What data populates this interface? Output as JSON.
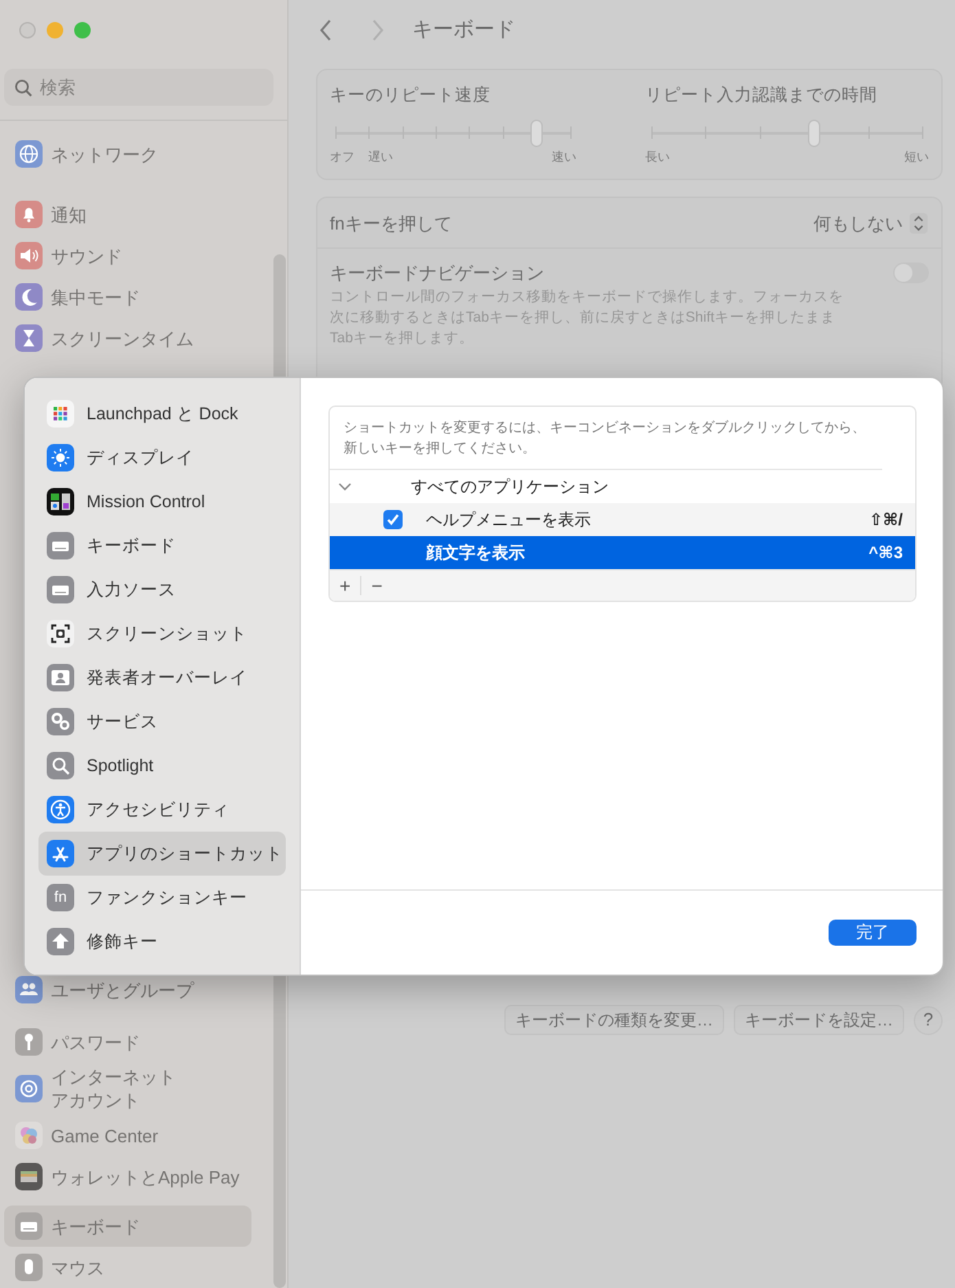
{
  "window": {
    "title": "キーボード"
  },
  "sidebar": {
    "search": {
      "placeholder": "検索"
    },
    "groups": [
      [
        {
          "label": "ネットワーク",
          "selected": false
        }
      ],
      [
        {
          "label": "通知",
          "selected": false
        },
        {
          "label": "サウンド",
          "selected": false
        },
        {
          "label": "集中モード",
          "selected": false
        },
        {
          "label": "スクリーンタイム",
          "selected": false
        }
      ],
      [
        {
          "label": "ユーザとグループ",
          "selected": false
        }
      ],
      [
        {
          "label": "パスワード",
          "selected": false
        },
        {
          "label": "インターネットアカウント",
          "selected": false
        },
        {
          "label": "Game Center",
          "selected": false
        },
        {
          "label": "ウォレットとApple Pay",
          "selected": false
        }
      ],
      [
        {
          "label": "キーボード",
          "selected": true
        },
        {
          "label": "マウス",
          "selected": false
        }
      ]
    ]
  },
  "repeat": {
    "sliders": [
      {
        "label": "キーのリピート速度",
        "level": 0.857,
        "left_labels": [
          "オフ",
          "遅い"
        ],
        "right_label": "速い"
      },
      {
        "label": "リピート入力認識までの時間",
        "level": 0.6,
        "left_labels": [
          "長い"
        ],
        "right_label": "短い"
      }
    ]
  },
  "fn_row": {
    "label": "fnキーを押して",
    "value": "何もしない"
  },
  "navigation": {
    "title": "キーボードナビゲーション",
    "description": "コントロール間のフォーカス移動をキーボードで操作します。フォーカスを次に移動するときはTabキーを押し、前に戻すときはShiftキーを押したままTabキーを押します。",
    "on": false
  },
  "buttons": [
    "キーボードの種類を変更…",
    "キーボードを設定…"
  ],
  "help": "?",
  "sheet": {
    "categories": [
      {
        "label": "Launchpad と Dock",
        "selected": false
      },
      {
        "label": "ディスプレイ",
        "selected": false
      },
      {
        "label": "Mission Control",
        "selected": false
      },
      {
        "label": "キーボード",
        "selected": false
      },
      {
        "label": "入力ソース",
        "selected": false
      },
      {
        "label": "スクリーンショット",
        "selected": false
      },
      {
        "label": "発表者オーバーレイ",
        "selected": false
      },
      {
        "label": "サービス",
        "selected": false
      },
      {
        "label": "Spotlight",
        "selected": false
      },
      {
        "label": "アクセシビリティ",
        "selected": false
      },
      {
        "label": "アプリのショートカット",
        "selected": true
      },
      {
        "label": "ファンクションキー",
        "selected": false,
        "badge": "fn"
      },
      {
        "label": "修飾キー",
        "selected": false
      }
    ],
    "hint": "ショートカットを変更するには、キーコンビネーションをダブルクリックしてから、新しいキーを押してください。",
    "groups": [
      {
        "label": "すべてのアプリケーション",
        "expanded": true,
        "shortcuts": [
          {
            "label": "ヘルプメニューを表示",
            "keys": "⇧⌘/",
            "checked": true,
            "selected": false
          },
          {
            "label": "顔文字を表示",
            "keys": "^⌘3",
            "selected": true
          }
        ]
      }
    ],
    "add": "+",
    "remove": "−",
    "done": "完了"
  }
}
